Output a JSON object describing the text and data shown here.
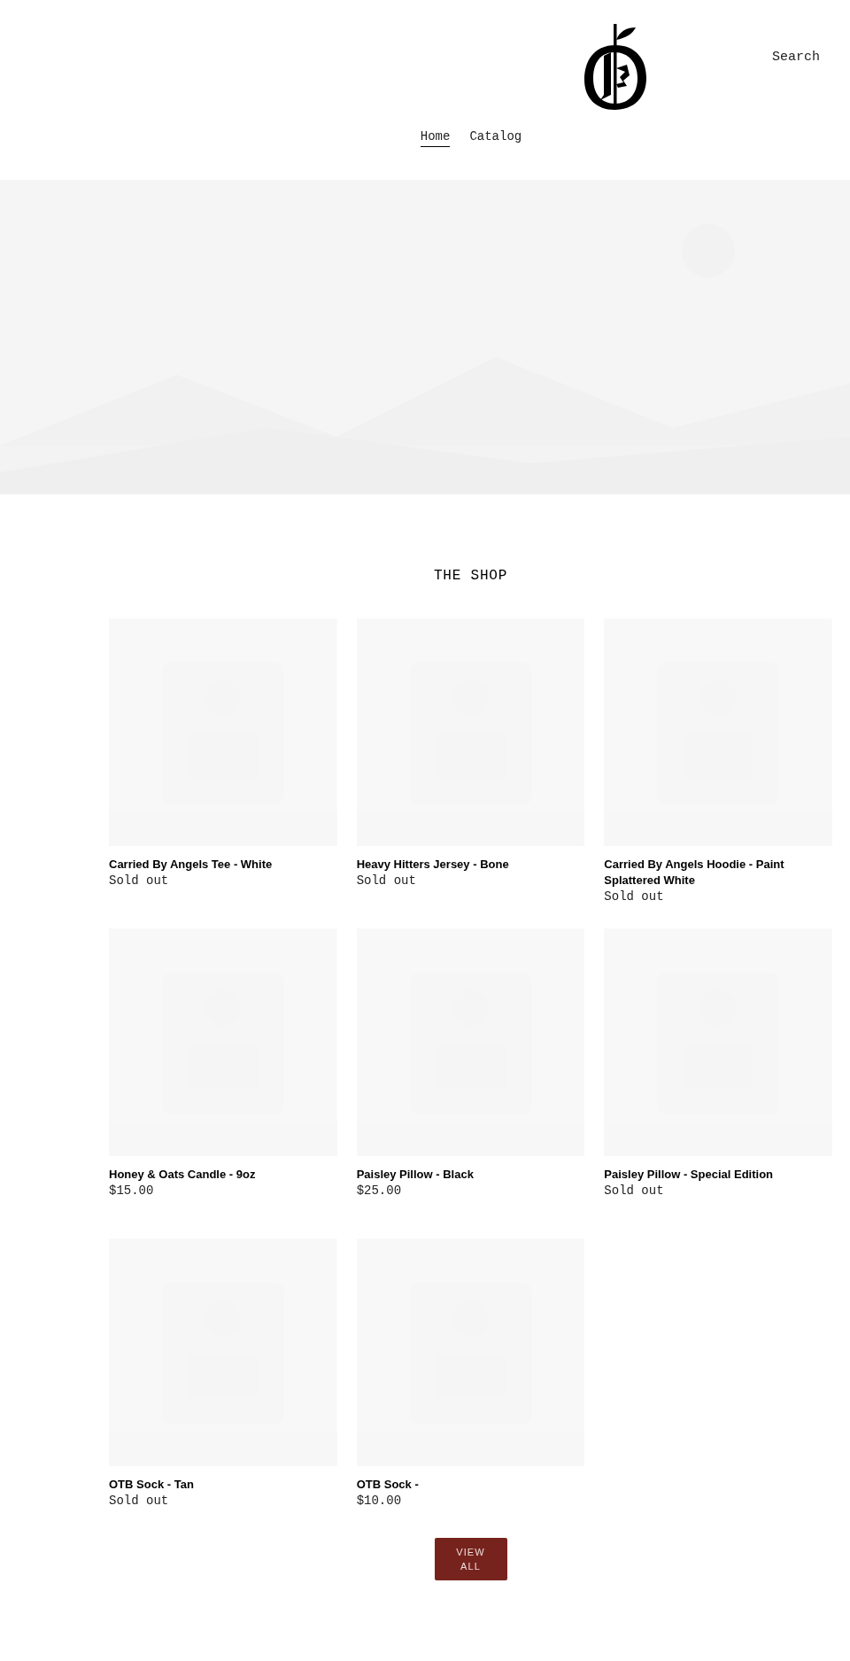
{
  "header": {
    "search_label": "Search",
    "nav": [
      {
        "label": "Home",
        "selected": true
      },
      {
        "label": "Catalog",
        "selected": false
      }
    ]
  },
  "shop": {
    "title": "THE SHOP",
    "products": [
      {
        "name": "Carried By Angels Tee - White",
        "price": "Sold out"
      },
      {
        "name": "Heavy Hitters Jersey - Bone",
        "price": "Sold out"
      },
      {
        "name": "Carried By Angels Hoodie - Paint Splattered White",
        "price": "Sold out"
      },
      {
        "name": "Honey & Oats Candle - 9oz",
        "price": "$15.00"
      },
      {
        "name": "Paisley Pillow - Black",
        "price": "$25.00"
      },
      {
        "name": "Paisley Pillow - Special Edition",
        "price": "Sold out"
      },
      {
        "name": "OTB Sock - Tan",
        "price": "Sold out"
      },
      {
        "name": "OTB Sock -",
        "price": "$10.00"
      }
    ],
    "button": "VIEW ALL"
  }
}
